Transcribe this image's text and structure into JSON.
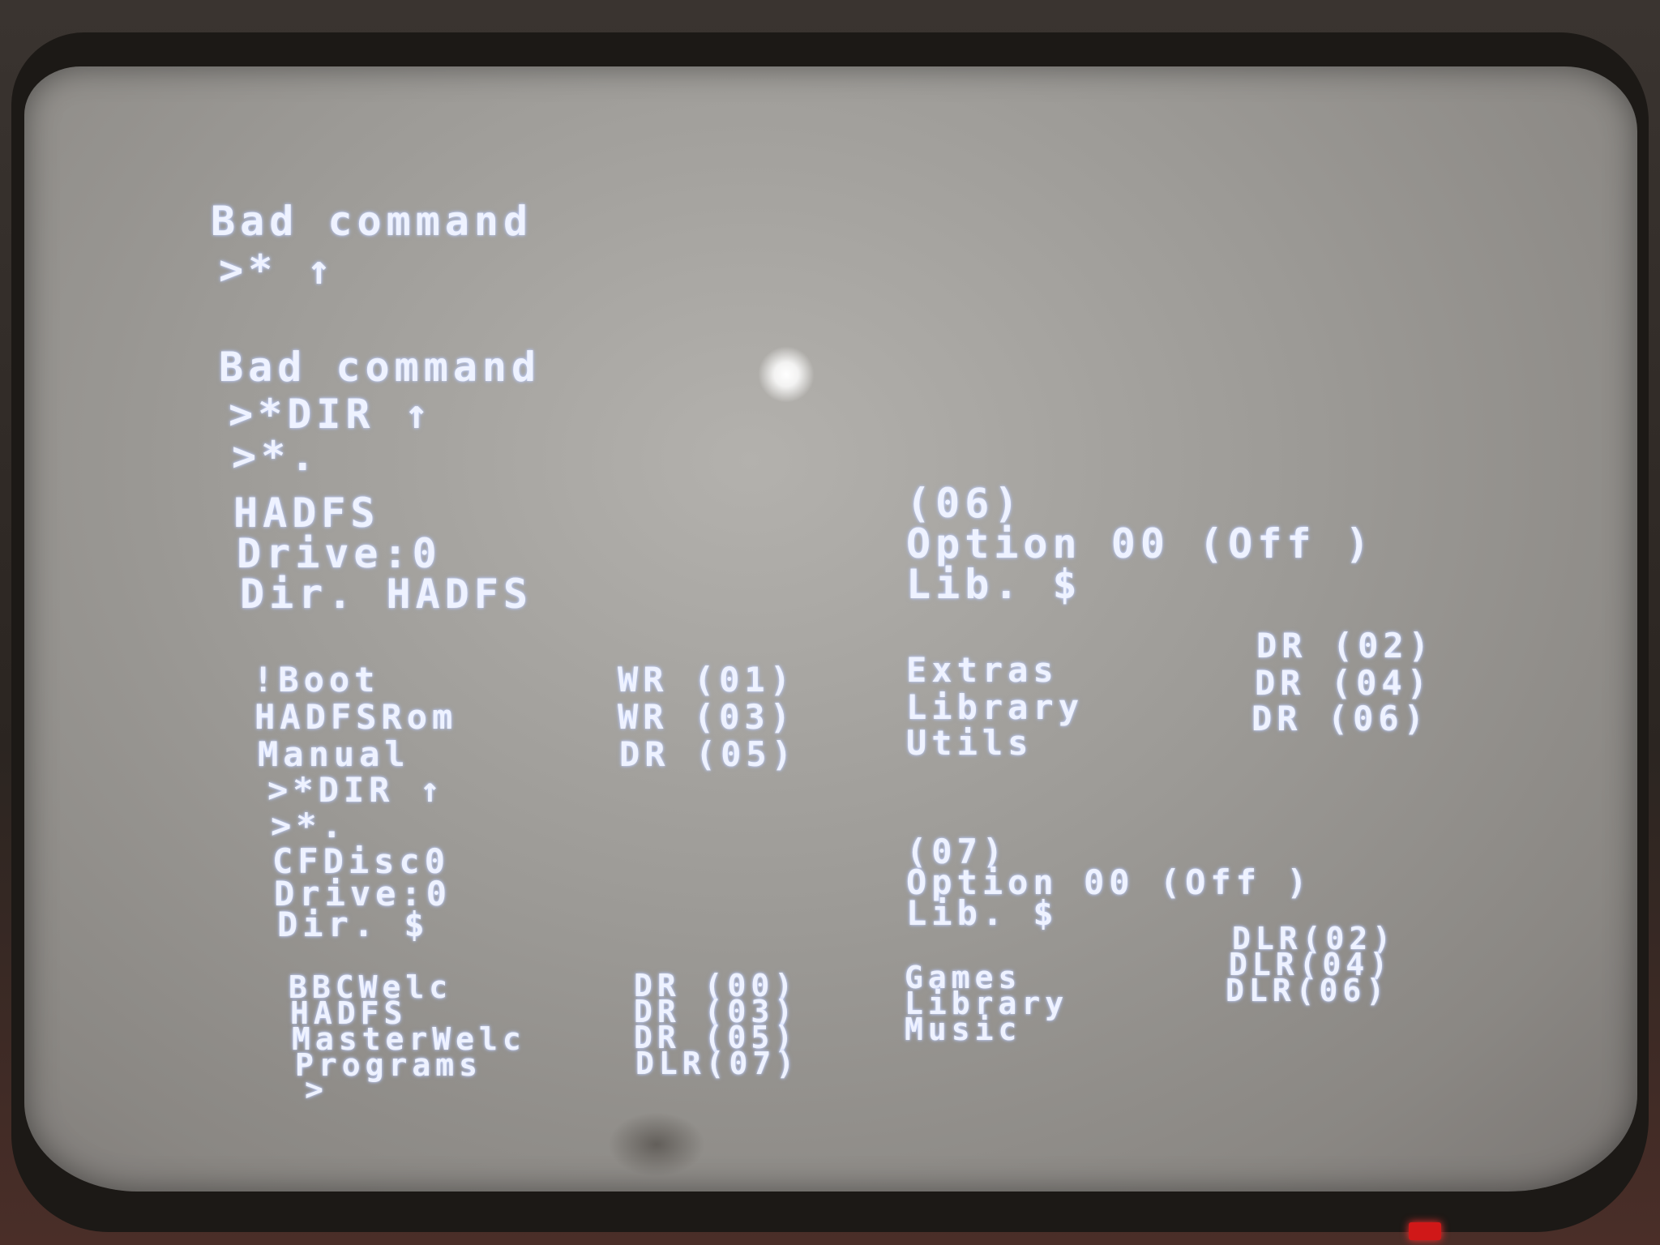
{
  "terminal": {
    "block1": {
      "error": "Bad command",
      "prompt": ">* ↑"
    },
    "block2": {
      "error": "Bad command",
      "cmd_dir": ">*DIR ↑",
      "cmd_cat": ">*.",
      "disc_title": "HADFS",
      "disc_number": "(06)",
      "drive": "Drive:0",
      "option": "Option 00 (Off )",
      "dir": "Dir. HADFS",
      "lib": "Lib. $",
      "files": [
        {
          "name": "!Boot",
          "attr": "WR (01)"
        },
        {
          "name": "HADFSRom",
          "attr": "WR (03)"
        },
        {
          "name": "Manual",
          "attr": "DR (05)"
        },
        {
          "name": "Extras",
          "attr": "DR (02)"
        },
        {
          "name": "Library",
          "attr": "DR (04)"
        },
        {
          "name": "Utils",
          "attr": "DR (06)"
        }
      ]
    },
    "block3": {
      "cmd_dir": ">*DIR ↑",
      "cmd_cat": ">*.",
      "disc_title": "CFDisc0",
      "disc_number": "(07)",
      "drive": "Drive:0",
      "option": "Option 00 (Off )",
      "dir": "Dir. $",
      "lib": "Lib. $",
      "files": [
        {
          "name": "BBCWelc",
          "attr": "DR (00)"
        },
        {
          "name": "HADFS",
          "attr": "DR (03)"
        },
        {
          "name": "MasterWelc",
          "attr": "DR (05)"
        },
        {
          "name": "Programs",
          "attr": "DLR(07)"
        },
        {
          "name": "Games",
          "attr": "DLR(02)"
        },
        {
          "name": "Library",
          "attr": "DLR(04)"
        },
        {
          "name": "Music",
          "attr": "DLR(06)"
        }
      ],
      "final_prompt": ">"
    }
  },
  "colors": {
    "screen": "#a9a7a3",
    "text": "#eef2ff",
    "bezel": "#1c1916",
    "power_led": "#d01818"
  }
}
